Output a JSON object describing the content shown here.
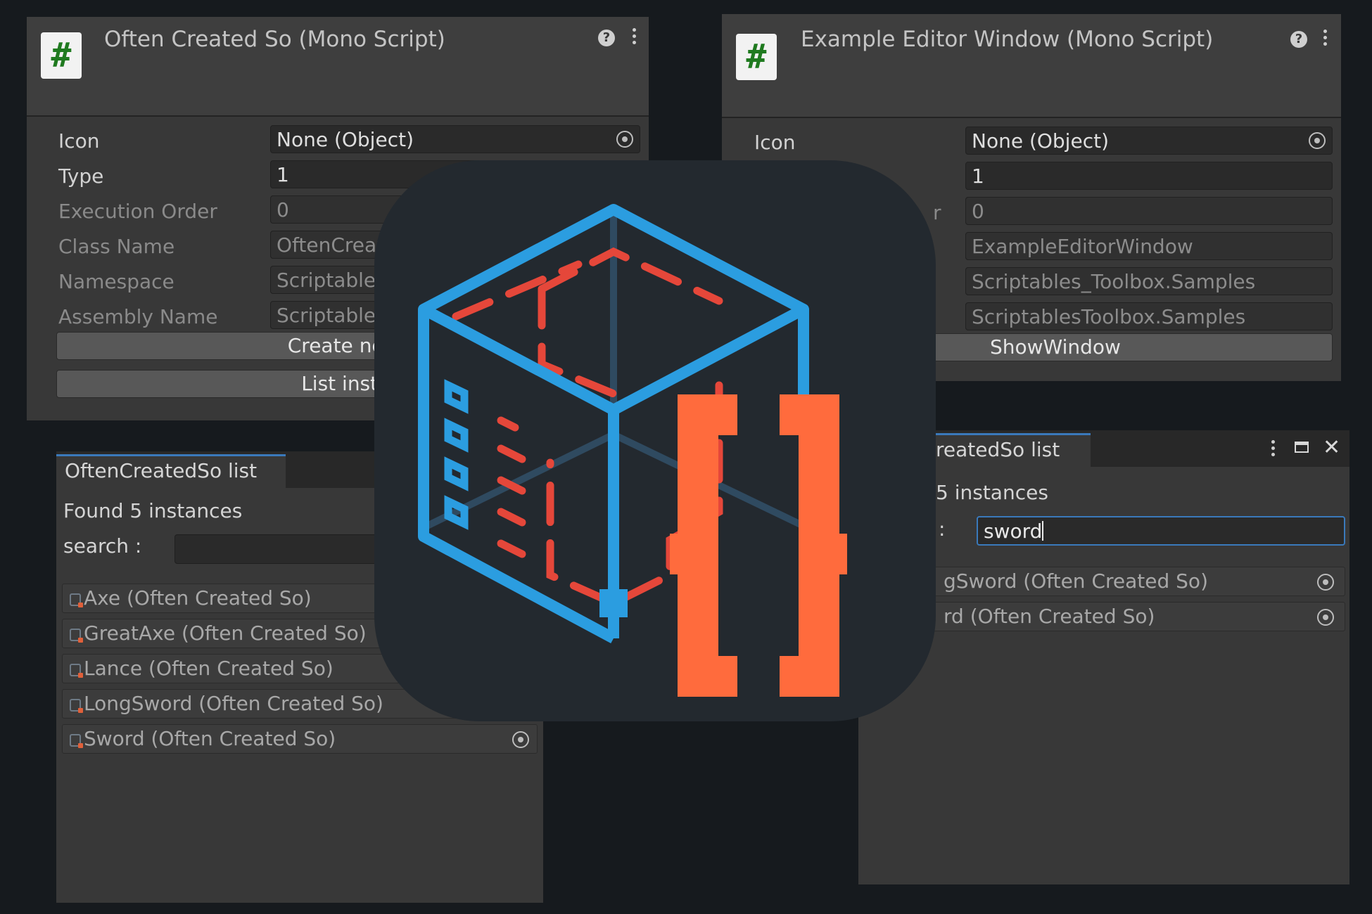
{
  "inspector_left": {
    "title": "Often Created So (Mono Script)",
    "fields": {
      "icon_label": "Icon",
      "icon_value": "None (Object)",
      "type_label": "Type",
      "type_value": "1",
      "exec_label": "Execution Order",
      "exec_value": "0",
      "class_label": "Class Name",
      "class_value": "OftenCreat",
      "namespace_label": "Namespace",
      "namespace_value": "Scriptable",
      "assembly_label": "Assembly Name",
      "assembly_value": "Scriptable"
    },
    "buttons": {
      "create": "Create new i",
      "list": "List instar"
    }
  },
  "inspector_right": {
    "title": "Example Editor Window (Mono Script)",
    "fields": {
      "icon_label": "Icon",
      "icon_value": "None (Object)",
      "type_value": "1",
      "exec_label_partial": "r",
      "exec_value": "0",
      "class_value": "ExampleEditorWindow",
      "namespace_value": "Scriptables_Toolbox.Samples",
      "assembly_value": "ScriptablesToolbox.Samples"
    },
    "buttons": {
      "show": "ShowWindow"
    }
  },
  "list_left": {
    "tab": "OftenCreatedSo list",
    "found": "Found 5 instances",
    "search_label": "search :",
    "search_value": "",
    "items": [
      "Axe (Often Created So)",
      "GreatAxe (Often Created So)",
      "Lance (Often Created So)",
      "LongSword (Often Created So)",
      "Sword (Often Created So)"
    ]
  },
  "list_right": {
    "tab": "reatedSo list",
    "found": "5 instances",
    "search_label": ":",
    "search_value": "sword",
    "items": [
      "gSword (Often Created So)",
      "rd (Often Created So)"
    ]
  },
  "colors": {
    "logo_bg": "#23292f",
    "cube_blue": "#2b9de0",
    "cube_red": "#e5473a",
    "brace_orange": "#ff6b3d",
    "accent_blue": "#3a79bb"
  },
  "icons": [
    "script-hash-icon",
    "help-icon",
    "kebab-menu-icon",
    "object-picker-icon",
    "scriptable-object-icon",
    "maximize-icon",
    "close-icon",
    "toolbox-logo"
  ]
}
